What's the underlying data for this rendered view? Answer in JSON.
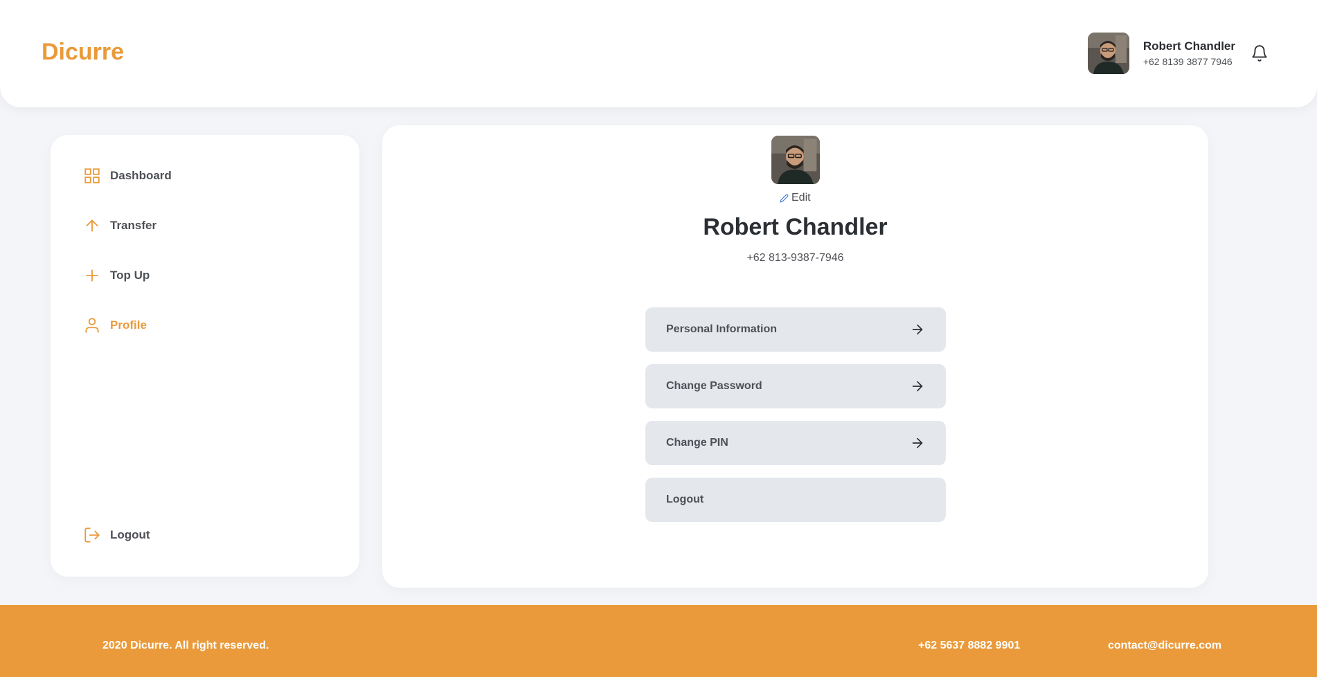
{
  "brand": {
    "name": "Dicurre",
    "color": "#ea9a3a"
  },
  "header": {
    "user_name": "Robert Chandler",
    "user_phone": "+62 8139 3877 7946",
    "avatar_icon": "user-photo",
    "notification_icon": "bell-icon"
  },
  "sidebar": {
    "items": [
      {
        "label": "Dashboard",
        "icon": "grid-icon",
        "active": false
      },
      {
        "label": "Transfer",
        "icon": "arrow-up-icon",
        "active": false
      },
      {
        "label": "Top Up",
        "icon": "plus-icon",
        "active": false
      },
      {
        "label": "Profile",
        "icon": "user-icon",
        "active": true
      }
    ],
    "logout_label": "Logout"
  },
  "profile": {
    "edit_label": "Edit",
    "name": "Robert Chandler",
    "phone": "+62 813-9387-7946",
    "menu": [
      {
        "label": "Personal Information",
        "has_arrow": true
      },
      {
        "label": "Change Password",
        "has_arrow": true
      },
      {
        "label": "Change PIN",
        "has_arrow": true
      },
      {
        "label": "Logout",
        "has_arrow": false
      }
    ]
  },
  "footer": {
    "copyright": "2020 Dicurre. All right reserved.",
    "phone": "+62 5637 8882 9901",
    "email": "contact@dicurre.com"
  },
  "colors": {
    "accent": "#ea9a3a",
    "button_bg": "#e4e7ec",
    "text": "#4d5055",
    "page_bg": "#f4f5f8"
  }
}
